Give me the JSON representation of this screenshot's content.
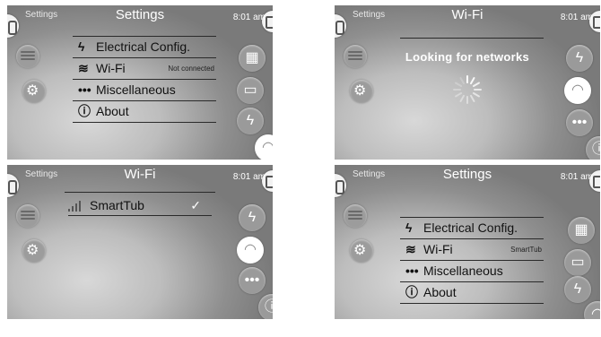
{
  "screen1": {
    "corner_label": "Settings",
    "title": "Settings",
    "time": "8:01 am",
    "menu": [
      {
        "icon": "lightning-icon",
        "label": "Electrical Config.",
        "sub": ""
      },
      {
        "icon": "wifi-icon",
        "label": "Wi-Fi",
        "sub": "Not connected"
      },
      {
        "icon": "dots-icon",
        "label": "Miscellaneous",
        "sub": ""
      },
      {
        "icon": "info-icon",
        "label": "About",
        "sub": ""
      }
    ]
  },
  "screen2": {
    "corner_label": "Settings",
    "title": "Wi-Fi",
    "time": "8:01 am",
    "status": "Looking for networks"
  },
  "screen3": {
    "corner_label": "Settings",
    "title": "Wi-Fi",
    "time": "8:01 am",
    "network": {
      "name": "SmartTub",
      "selected_mark": "✓"
    }
  },
  "screen4": {
    "corner_label": "Settings",
    "title": "Settings",
    "time": "8:01 am",
    "menu": [
      {
        "icon": "lightning-icon",
        "label": "Electrical Config.",
        "sub": ""
      },
      {
        "icon": "wifi-icon",
        "label": "Wi-Fi",
        "sub": "SmartTub"
      },
      {
        "icon": "dots-icon",
        "label": "Miscellaneous",
        "sub": ""
      },
      {
        "icon": "info-icon",
        "label": "About",
        "sub": ""
      }
    ]
  },
  "colors": {
    "accent_white": "#ffffff",
    "panel_gray": "#9a9a9a",
    "line_dark": "#2a2a2a"
  }
}
